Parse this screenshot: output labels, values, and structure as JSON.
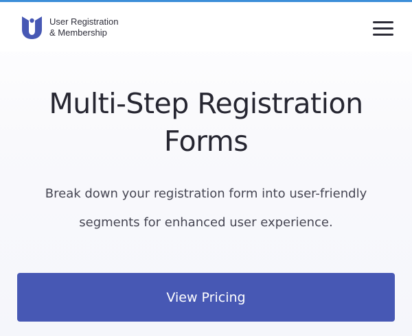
{
  "header": {
    "brand_line1": "User Registration",
    "brand_line2": "& Membership",
    "logo_icon": "user-registration-logo-icon",
    "menu_icon": "hamburger-menu-icon"
  },
  "hero": {
    "title_line1": "Multi-Step Registration",
    "title_line2": "Forms",
    "subtitle_line1": "Break down your registration form into user-friendly",
    "subtitle_line2": "segments for enhanced user experience.",
    "cta_label": "View Pricing"
  },
  "colors": {
    "accent_bar": "#3c8ed8",
    "brand_blue": "#4758b4",
    "text": "#262631"
  }
}
